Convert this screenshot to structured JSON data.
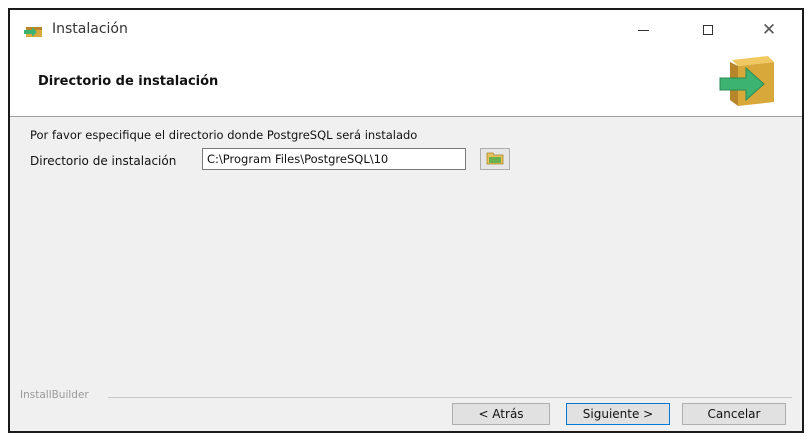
{
  "window": {
    "title": "Instalación",
    "icons": {
      "app": "postgresql-installer-icon",
      "minimize": "minimize-icon",
      "maximize": "maximize-icon",
      "close": "close-icon"
    },
    "close_glyph": "✕"
  },
  "header": {
    "title": "Directorio de instalación",
    "graphic": "box-arrow-icon"
  },
  "content": {
    "description": "Por favor especifique el directorio donde PostgreSQL será instalado",
    "dir_label": "Directorio de instalación",
    "dir_value": "C:\\Program Files\\PostgreSQL\\10",
    "browse_icon": "folder-icon"
  },
  "footer": {
    "brand": "InstallBuilder",
    "back_label": "< Atrás",
    "next_label": "Siguiente >",
    "cancel_label": "Cancelar"
  },
  "colors": {
    "accent": "#0078d7",
    "arrow_green": "#3cb371",
    "box_tan": "#e0b04a"
  }
}
